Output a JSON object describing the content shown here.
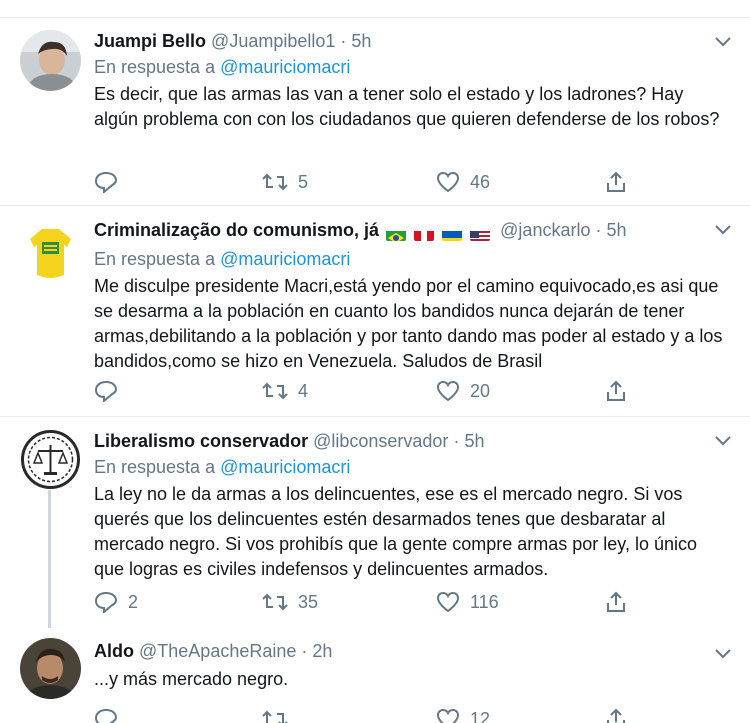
{
  "tweets": [
    {
      "name": "Juampi Bello",
      "handle": "@Juampibello1",
      "time": "5h",
      "reply_prefix": "En respuesta a",
      "reply_to": "@mauriciomacri",
      "text": "Es decir, que las armas las van a tener solo el estado y los ladrones? Hay algún problema con con los ciudadanos que quieren defenderse de los robos?",
      "replies": "",
      "retweets": "5",
      "likes": "46"
    },
    {
      "name": "Criminalização do comunismo, já",
      "flags": [
        "brazil-flag",
        "peru-flag",
        "ukraine-flag",
        "usa-flag"
      ],
      "handle": "@janckarlo",
      "time": "5h",
      "reply_prefix": "En respuesta a",
      "reply_to": "@mauriciomacri",
      "text": "Me disculpe presidente Macri,está yendo por el camino equivocado,es asi que se desarma a la población en cuanto los bandidos nunca dejarán de tener armas,debilitando a la población y por tanto dando mas poder al estado y a los bandidos,como se hizo en Venezuela. Saludos de Brasil",
      "replies": "",
      "retweets": "4",
      "likes": "20"
    },
    {
      "name": "Liberalismo conservador",
      "handle": "@libconservador",
      "time": "5h",
      "reply_prefix": "En respuesta a",
      "reply_to": "@mauriciomacri",
      "text": "La ley no le da armas a los delincuentes, ese es el mercado negro. Si vos querés que los delincuentes estén desarmados tenes que desbaratar al mercado negro. Si vos prohibís que la gente compre armas por ley, lo único que logras es civiles indefensos y delincuentes armados.",
      "replies": "2",
      "retweets": "35",
      "likes": "116"
    },
    {
      "name": "Aldo",
      "handle": "@TheApacheRaine",
      "time": "2h",
      "text": "...y más mercado negro.",
      "replies": "",
      "retweets": "",
      "likes": "12"
    }
  ],
  "separator": "·",
  "colors": {
    "link": "#1b95e0",
    "secondary_text": "#657786",
    "primary_text": "#14171a",
    "border": "#e6ecf0",
    "thread_line": "#ccd6dd"
  }
}
